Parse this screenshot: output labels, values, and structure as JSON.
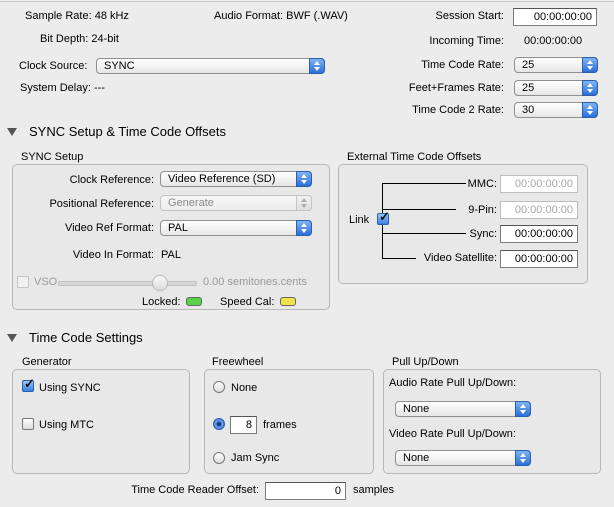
{
  "header": {
    "sample_rate": "Sample Rate: 48 kHz",
    "bit_depth": "Bit Depth: 24-bit",
    "audio_format": "Audio Format: BWF (.WAV)",
    "clock_source_label": "Clock Source:",
    "clock_source_value": "SYNC",
    "system_delay": "System Delay: ---",
    "session_start_label": "Session Start:",
    "session_start_value": "00:00:00:00",
    "incoming_time_label": "Incoming Time:",
    "incoming_time_value": "00:00:00:00",
    "time_code_rate_label": "Time Code Rate:",
    "time_code_rate_value": "25",
    "feet_frames_rate_label": "Feet+Frames Rate:",
    "feet_frames_rate_value": "25",
    "time_code2_rate_label": "Time Code 2 Rate:",
    "time_code2_rate_value": "30"
  },
  "sync_section": {
    "title": "SYNC Setup & Time Code Offsets",
    "setup_group_title": "SYNC Setup",
    "clock_reference_label": "Clock Reference:",
    "clock_reference_value": "Video Reference (SD)",
    "positional_reference_label": "Positional Reference:",
    "positional_reference_value": "Generate",
    "video_ref_format_label": "Video Ref Format:",
    "video_ref_format_value": "PAL",
    "video_in_format_label": "Video In Format:",
    "video_in_format_value": "PAL",
    "vso_label": "VSO",
    "vso_value": "0.00  semitones.cents",
    "locked_label": "Locked:",
    "speed_cal_label": "Speed Cal:",
    "locked_color": "#59d44a",
    "speed_cal_color": "#f2e24a",
    "offsets_group_title": "External Time Code Offsets",
    "link_label": "Link",
    "mmc_label": "MMC:",
    "mmc_value": "00:00:00:00",
    "ninepin_label": "9-Pin:",
    "ninepin_value": "00:00:00:00",
    "sync_label": "Sync:",
    "sync_value": "00:00:00:00",
    "video_satellite_label": "Video Satellite:",
    "video_satellite_value": "00:00:00:00"
  },
  "tc_section": {
    "title": "Time Code Settings",
    "generator_title": "Generator",
    "using_sync_label": "Using SYNC",
    "using_mtc_label": "Using MTC",
    "freewheel_title": "Freewheel",
    "none_label": "None",
    "frames_value": "8",
    "frames_label": "frames",
    "jam_sync_label": "Jam Sync",
    "pullupdown_title": "Pull Up/Down",
    "audio_pull_label": "Audio Rate Pull Up/Down:",
    "audio_pull_value": "None",
    "video_pull_label": "Video Rate Pull Up/Down:",
    "video_pull_value": "None",
    "reader_offset_label": "Time Code Reader Offset:",
    "reader_offset_value": "0",
    "reader_offset_unit": "samples"
  }
}
